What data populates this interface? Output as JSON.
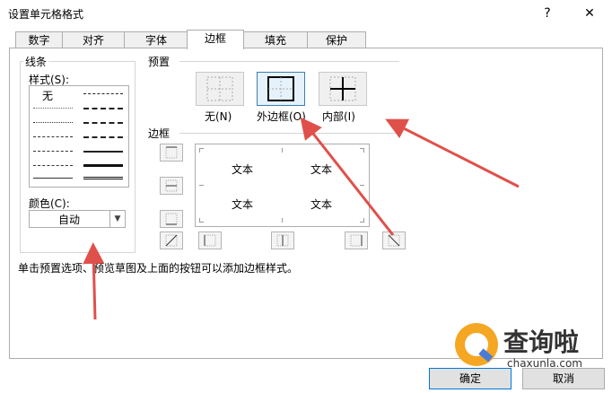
{
  "window": {
    "title": "设置单元格格式",
    "help_label": "?",
    "close_label": "✕"
  },
  "tabs": [
    {
      "label": "数字"
    },
    {
      "label": "对齐"
    },
    {
      "label": "字体"
    },
    {
      "label": "边框",
      "active": true
    },
    {
      "label": "填充"
    },
    {
      "label": "保护"
    }
  ],
  "line_group": {
    "title": "线条",
    "style_label": "样式(S):",
    "none_option": "无",
    "color_label": "颜色(C):",
    "color_value": "自动"
  },
  "presets": {
    "title": "预置",
    "items": [
      {
        "label": "无(N)"
      },
      {
        "label": "外边框(O)",
        "selected": true
      },
      {
        "label": "内部(I)"
      }
    ]
  },
  "border": {
    "title": "边框",
    "preview_texts": [
      "文本",
      "文本",
      "文本",
      "文本"
    ]
  },
  "hint": "单击预置选项、预览草图及上面的按钮可以添加边框样式。",
  "buttons": {
    "ok": "确定",
    "cancel": "取消"
  },
  "watermark": {
    "text": "查询啦",
    "url": "chaxunla.com"
  },
  "colors": {
    "arrow": "#e0504a",
    "accent": "#0078d7",
    "selected_bg": "#e5f1fb"
  }
}
